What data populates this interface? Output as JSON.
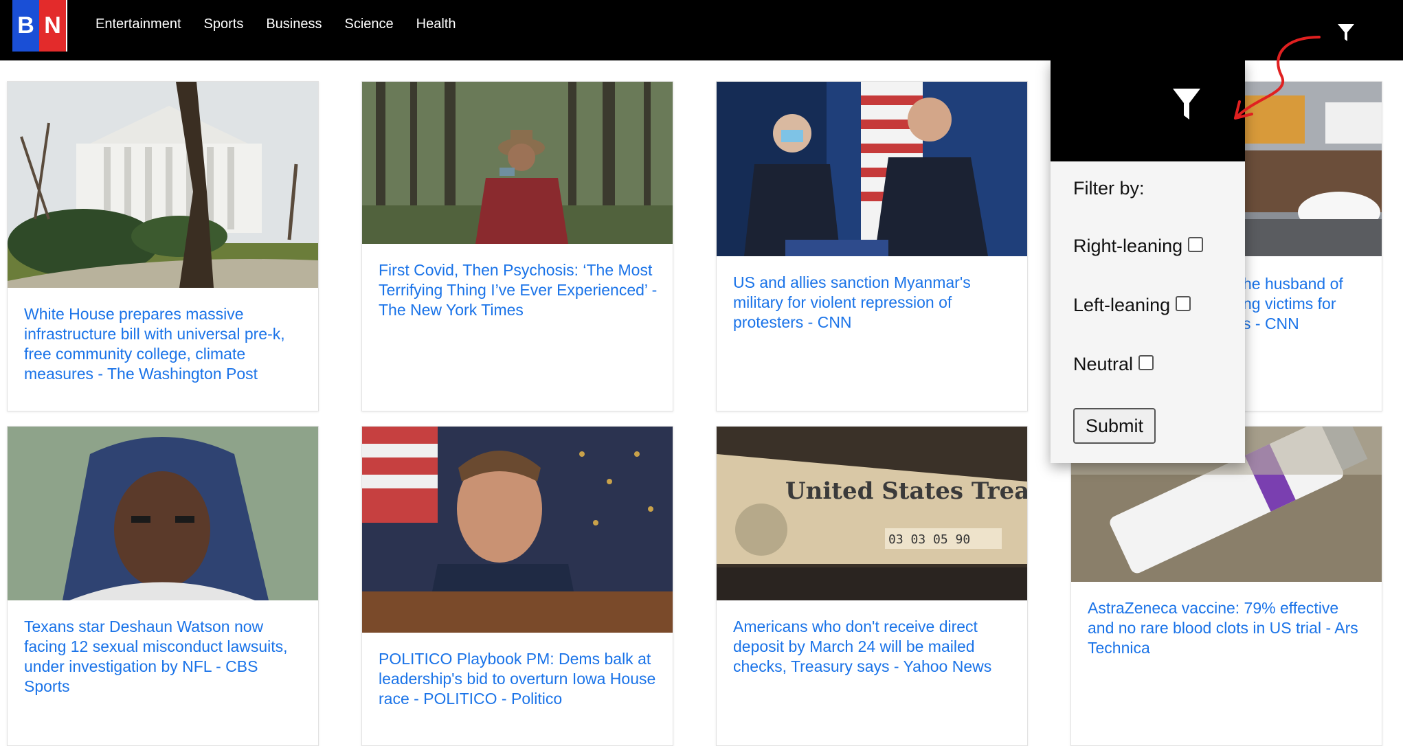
{
  "brand": {
    "logo_left": "B",
    "logo_right": "N"
  },
  "nav": {
    "links": [
      "Entertainment",
      "Sports",
      "Business",
      "Science",
      "Health"
    ],
    "filter_icon": "filter-icon"
  },
  "articles": [
    {
      "title": "White House prepares massive infrastructure bill with universal pre-k, free community college, climate measures - The Washington Post"
    },
    {
      "title": "First Covid, Then Psychosis: ‘The Most Terrifying Thing I’ve Ever Experienced’ - The New York Times"
    },
    {
      "title": "US and allies sanction Myanmar's military for violent repression of protesters - CNN"
    },
    {
      "title": "…he husband of …ng victims for …s - CNN"
    },
    {
      "title": "Texans star Deshaun Watson now facing 12 sexual misconduct lawsuits, under investigation by NFL - CBS Sports"
    },
    {
      "title": "POLITICO Playbook PM: Dems balk at leadership's bid to overturn Iowa House race - POLITICO - Politico"
    },
    {
      "title": "Americans who don't receive direct deposit by March 24 will be mailed checks, Treasury says - Yahoo News"
    },
    {
      "title": "AstraZeneca vaccine: 79% effective and no rare blood clots in US trial - Ars Technica"
    }
  ],
  "card4_visible_lines": [
    "he husband of",
    "ng victims for",
    "s - CNN"
  ],
  "image_texts": {
    "treasury": "United States Treasury",
    "treasury_numbers": "03 03 05 90"
  },
  "filter": {
    "label": "Filter by:",
    "options": [
      "Right-leaning",
      "Left-leaning",
      "Neutral"
    ],
    "submit_label": "Submit"
  },
  "colors": {
    "link": "#1a73e8",
    "nav_bg": "#000000",
    "logo_blue": "#1a4fd6",
    "logo_red": "#e32b2b",
    "annotation": "#e02020"
  }
}
